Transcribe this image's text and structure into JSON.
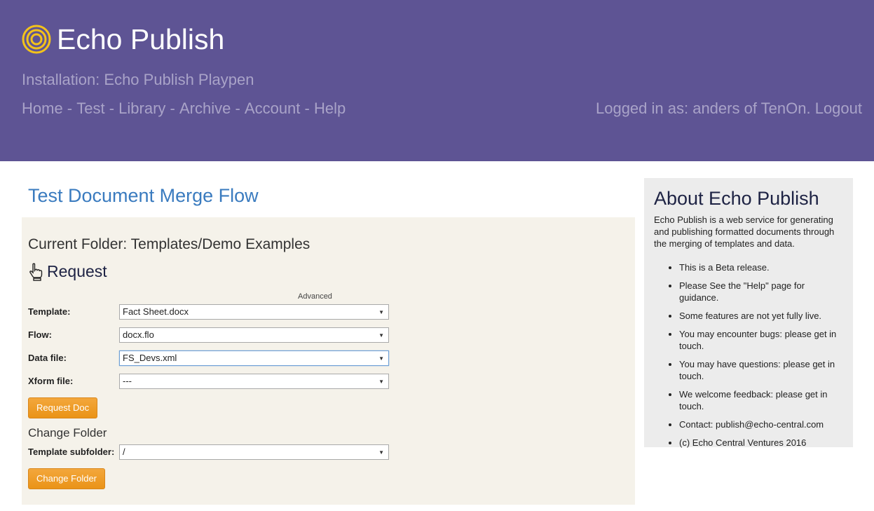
{
  "header": {
    "brand": "Echo Publish",
    "installation": "Installation: Echo Publish Playpen",
    "nav": [
      {
        "label": "Home"
      },
      {
        "label": "Test"
      },
      {
        "label": "Library"
      },
      {
        "label": "Archive"
      },
      {
        "label": "Account"
      },
      {
        "label": "Help"
      }
    ],
    "nav_separator": " - ",
    "login_text": "Logged in as: anders of TenOn.",
    "logout_label": "Logout",
    "colors": {
      "background": "#5e5494",
      "muted_text": "#a9a3c8",
      "logo": "#f2c21b"
    },
    "icons": {
      "logo": "concentric-circles-logo-icon"
    }
  },
  "main": {
    "title": "Test Document Merge Flow",
    "current_folder": "Current Folder: Templates/Demo Examples",
    "request_title": "Request",
    "request_icon": "pointing-hand-icon",
    "advanced_label": "Advanced",
    "fields": {
      "template": {
        "label": "Template:",
        "value": "Fact Sheet.docx"
      },
      "flow": {
        "label": "Flow:",
        "value": "docx.flo"
      },
      "data_file": {
        "label": "Data file:",
        "value": "FS_Devs.xml"
      },
      "xform_file": {
        "label": "Xform file:",
        "value": "---"
      }
    },
    "request_button": "Request Doc",
    "change_folder_title": "Change Folder",
    "subfolder": {
      "label": "Template subfolder:",
      "value": "/"
    },
    "change_folder_button": "Change Folder",
    "colors": {
      "title": "#3a7bbf",
      "panel": "#f5f2ea",
      "button": "#ea9317"
    }
  },
  "sidebar": {
    "title": "About Echo Publish",
    "description": "Echo Publish is a web service for generating and publishing formatted documents through the merging of templates and data.",
    "items": [
      "This is a Beta release.",
      "Please See the \"Help\" page for guidance.",
      "Some features are not yet fully live.",
      "You may encounter bugs: please get in touch.",
      "You may have questions: please get in touch.",
      "We welcome feedback: please get in touch.",
      "Contact: publish@echo-central.com",
      "(c) Echo Central Ventures 2016"
    ]
  }
}
